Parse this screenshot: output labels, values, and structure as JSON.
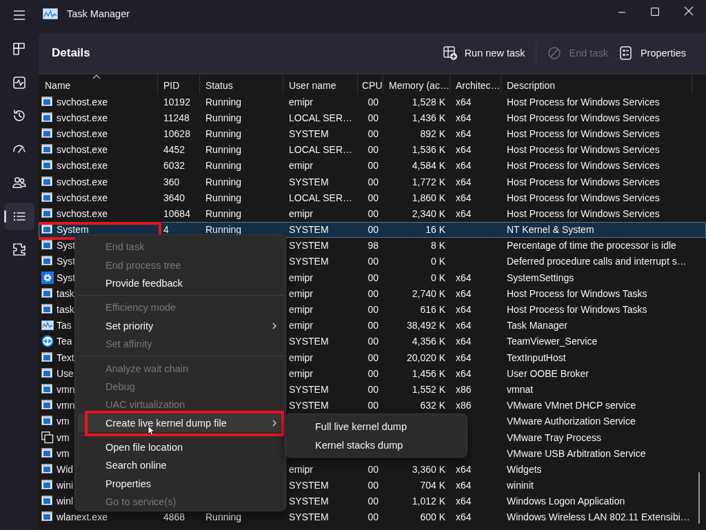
{
  "window": {
    "title": "Task Manager"
  },
  "sidebar": {
    "items": [
      {
        "kind": "processes",
        "selected": false
      },
      {
        "kind": "performance",
        "selected": false
      },
      {
        "kind": "app-history",
        "selected": false
      },
      {
        "kind": "startup",
        "selected": false
      },
      {
        "kind": "users",
        "selected": false
      },
      {
        "kind": "details",
        "selected": true
      },
      {
        "kind": "services",
        "selected": false
      }
    ]
  },
  "page": {
    "title": "Details",
    "toolbar": [
      {
        "kind": "run",
        "label": "Run new task",
        "disabled": false
      },
      {
        "kind": "end",
        "label": "End task",
        "disabled": true
      },
      {
        "kind": "properties",
        "label": "Properties",
        "disabled": false
      }
    ]
  },
  "table": {
    "columns": [
      {
        "label": "Name",
        "sorted": true
      },
      {
        "label": "PID",
        "sorted": false
      },
      {
        "label": "Status",
        "sorted": false
      },
      {
        "label": "User name",
        "sorted": false
      },
      {
        "label": "CPU",
        "sorted": false
      },
      {
        "label": "Memory (ac…",
        "sorted": false
      },
      {
        "label": "Architec…",
        "sorted": false
      },
      {
        "label": "Description",
        "sorted": false
      }
    ],
    "rows": [
      {
        "kind": "window",
        "name": "svchost.exe",
        "pid": "10192",
        "status": "Running",
        "user": "emipr",
        "cpu": "00",
        "memory": "1,528 K",
        "arch": "x64",
        "description": "Host Process for Windows Services",
        "selected": false,
        "highlighted": false
      },
      {
        "kind": "window",
        "name": "svchost.exe",
        "pid": "11248",
        "status": "Running",
        "user": "LOCAL SER…",
        "cpu": "00",
        "memory": "1,436 K",
        "arch": "x64",
        "description": "Host Process for Windows Services",
        "selected": false,
        "highlighted": false
      },
      {
        "kind": "window",
        "name": "svchost.exe",
        "pid": "10628",
        "status": "Running",
        "user": "SYSTEM",
        "cpu": "00",
        "memory": "892 K",
        "arch": "x64",
        "description": "Host Process for Windows Services",
        "selected": false,
        "highlighted": false
      },
      {
        "kind": "window",
        "name": "svchost.exe",
        "pid": "4452",
        "status": "Running",
        "user": "LOCAL SER…",
        "cpu": "00",
        "memory": "1,536 K",
        "arch": "x64",
        "description": "Host Process for Windows Services",
        "selected": false,
        "highlighted": false
      },
      {
        "kind": "window",
        "name": "svchost.exe",
        "pid": "6032",
        "status": "Running",
        "user": "emipr",
        "cpu": "00",
        "memory": "4,584 K",
        "arch": "x64",
        "description": "Host Process for Windows Services",
        "selected": false,
        "highlighted": false
      },
      {
        "kind": "window",
        "name": "svchost.exe",
        "pid": "360",
        "status": "Running",
        "user": "SYSTEM",
        "cpu": "00",
        "memory": "1,772 K",
        "arch": "x64",
        "description": "Host Process for Windows Services",
        "selected": false,
        "highlighted": false
      },
      {
        "kind": "window",
        "name": "svchost.exe",
        "pid": "3640",
        "status": "Running",
        "user": "LOCAL SER…",
        "cpu": "00",
        "memory": "1,860 K",
        "arch": "x64",
        "description": "Host Process for Windows Services",
        "selected": false,
        "highlighted": false
      },
      {
        "kind": "window",
        "name": "svchost.exe",
        "pid": "10684",
        "status": "Running",
        "user": "emipr",
        "cpu": "00",
        "memory": "2,340 K",
        "arch": "x64",
        "description": "Host Process for Windows Services",
        "selected": false,
        "highlighted": false
      },
      {
        "kind": "window",
        "name": "System",
        "pid": "4",
        "status": "Running",
        "user": "SYSTEM",
        "cpu": "00",
        "memory": "16 K",
        "description": "NT Kernel & System",
        "selected": true,
        "highlighted": true
      },
      {
        "kind": "window",
        "name": "Syst",
        "user": "SYSTEM",
        "cpu": "98",
        "memory": "8 K",
        "description": "Percentage of time the processor is idle",
        "selected": false,
        "highlighted": false
      },
      {
        "kind": "window",
        "name": "Syst",
        "user": "SYSTEM",
        "cpu": "00",
        "memory": "0 K",
        "description": "Deferred procedure calls and interrupt s…",
        "selected": false,
        "highlighted": false
      },
      {
        "kind": "gear",
        "name": "Syst",
        "user": "emipr",
        "cpu": "00",
        "memory": "0 K",
        "arch": "x64",
        "description": "SystemSettings",
        "selected": false,
        "highlighted": false
      },
      {
        "kind": "window",
        "name": "task",
        "user": "emipr",
        "cpu": "00",
        "memory": "2,740 K",
        "arch": "x64",
        "description": "Host Process for Windows Tasks",
        "selected": false,
        "highlighted": false
      },
      {
        "kind": "window",
        "name": "task",
        "user": "emipr",
        "cpu": "00",
        "memory": "616 K",
        "arch": "x64",
        "description": "Host Process for Windows Tasks",
        "selected": false,
        "highlighted": false
      },
      {
        "kind": "chart",
        "name": "Tas",
        "user": "emipr",
        "cpu": "00",
        "memory": "38,492 K",
        "arch": "x64",
        "description": "Task Manager",
        "selected": false,
        "highlighted": false
      },
      {
        "kind": "remote",
        "name": "Tea",
        "user": "SYSTEM",
        "cpu": "00",
        "memory": "4,356 K",
        "arch": "x64",
        "description": "TeamViewer_Service",
        "selected": false,
        "highlighted": false
      },
      {
        "kind": "window",
        "name": "Text",
        "user": "emipr",
        "cpu": "00",
        "memory": "20,020 K",
        "arch": "x64",
        "description": "TextInputHost",
        "selected": false,
        "highlighted": false
      },
      {
        "kind": "window",
        "name": "Use",
        "user": "emipr",
        "cpu": "00",
        "memory": "1,456 K",
        "arch": "x64",
        "description": "User OOBE Broker",
        "selected": false,
        "highlighted": false
      },
      {
        "kind": "window",
        "name": "vmn",
        "user": "SYSTEM",
        "cpu": "00",
        "memory": "1,552 K",
        "arch": "x86",
        "description": "vmnat",
        "selected": false,
        "highlighted": false
      },
      {
        "kind": "window",
        "name": "vmn",
        "user": "SYSTEM",
        "cpu": "00",
        "memory": "632 K",
        "arch": "x86",
        "description": "VMware VMnet DHCP service",
        "selected": false,
        "highlighted": false
      },
      {
        "kind": "window",
        "name": "vm",
        "description": "VMware Authorization Service",
        "selected": false,
        "highlighted": false
      },
      {
        "kind": "copy",
        "name": "vm",
        "description": "VMware Tray Process",
        "selected": false,
        "highlighted": false
      },
      {
        "kind": "window",
        "name": "vm",
        "description": "VMware USB Arbitration Service",
        "selected": false,
        "highlighted": false
      },
      {
        "kind": "window",
        "name": "Wid",
        "user": "emipr",
        "cpu": "00",
        "memory": "3,360 K",
        "arch": "x64",
        "description": "Widgets",
        "selected": false,
        "highlighted": false
      },
      {
        "kind": "window",
        "name": "wini",
        "user": "SYSTEM",
        "cpu": "00",
        "memory": "704 K",
        "arch": "x64",
        "description": "wininit",
        "selected": false,
        "highlighted": false
      },
      {
        "kind": "window",
        "name": "winl",
        "user": "SYSTEM",
        "cpu": "00",
        "memory": "1,012 K",
        "arch": "x64",
        "description": "Windows Logon Application",
        "selected": false,
        "highlighted": false
      },
      {
        "kind": "window",
        "name": "wlanext.exe",
        "pid": "4868",
        "status": "Running",
        "user": "SYSTEM",
        "cpu": "00",
        "memory": "600 K",
        "arch": "x64",
        "description": "Windows Wireless LAN 802.11 Extensibi…",
        "selected": false,
        "highlighted": false
      }
    ]
  },
  "context_menu": {
    "items": [
      {
        "kind": "item",
        "label": "End task",
        "disabled": true,
        "submenu": false,
        "hovered": false,
        "highlighted": false
      },
      {
        "kind": "item",
        "label": "End process tree",
        "disabled": true,
        "submenu": false,
        "hovered": false,
        "highlighted": false
      },
      {
        "kind": "item",
        "label": "Provide feedback",
        "disabled": false,
        "submenu": false,
        "hovered": false,
        "highlighted": false
      },
      {
        "kind": "separator"
      },
      {
        "kind": "item",
        "label": "Efficiency mode",
        "disabled": true,
        "submenu": false,
        "hovered": false,
        "highlighted": false
      },
      {
        "kind": "item",
        "label": "Set priority",
        "disabled": false,
        "submenu": true,
        "hovered": false,
        "highlighted": false
      },
      {
        "kind": "item",
        "label": "Set affinity",
        "disabled": true,
        "submenu": false,
        "hovered": false,
        "highlighted": false
      },
      {
        "kind": "separator"
      },
      {
        "kind": "item",
        "label": "Analyze wait chain",
        "disabled": true,
        "submenu": false,
        "hovered": false,
        "highlighted": false
      },
      {
        "kind": "item",
        "label": "Debug",
        "disabled": true,
        "submenu": false,
        "hovered": false,
        "highlighted": false
      },
      {
        "kind": "item",
        "label": "UAC virtualization",
        "disabled": true,
        "submenu": false,
        "hovered": false,
        "highlighted": false
      },
      {
        "kind": "item",
        "label": "Create live kernel dump file",
        "disabled": false,
        "submenu": true,
        "hovered": true,
        "highlighted": true
      },
      {
        "kind": "separator"
      },
      {
        "kind": "item",
        "label": "Open file location",
        "disabled": false,
        "submenu": false,
        "hovered": false,
        "highlighted": false
      },
      {
        "kind": "item",
        "label": "Search online",
        "disabled": false,
        "submenu": false,
        "hovered": false,
        "highlighted": false
      },
      {
        "kind": "item",
        "label": "Properties",
        "disabled": false,
        "submenu": false,
        "hovered": false,
        "highlighted": false
      },
      {
        "kind": "item",
        "label": "Go to service(s)",
        "disabled": true,
        "submenu": false,
        "hovered": false,
        "highlighted": false
      }
    ]
  },
  "submenu": {
    "items": [
      {
        "label": "Full live kernel dump"
      },
      {
        "label": "Kernel stacks dump"
      }
    ]
  }
}
